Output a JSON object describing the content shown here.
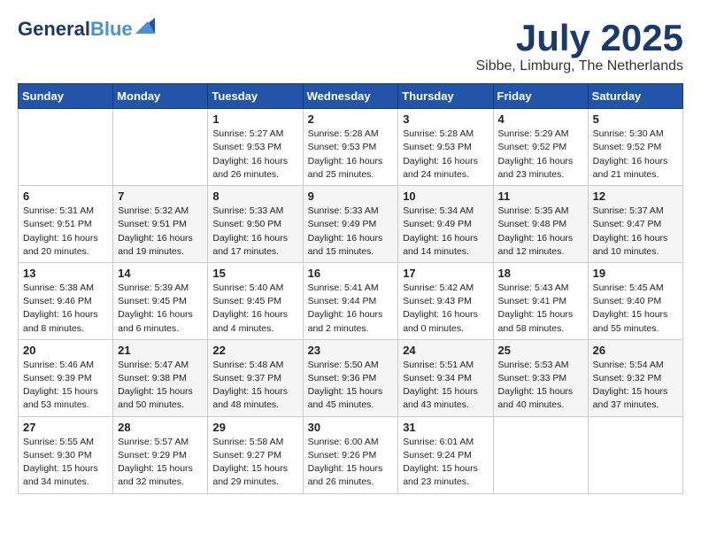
{
  "logo": {
    "line1": "General",
    "line2": "Blue"
  },
  "title": "July 2025",
  "location": "Sibbe, Limburg, The Netherlands",
  "weekdays": [
    "Sunday",
    "Monday",
    "Tuesday",
    "Wednesday",
    "Thursday",
    "Friday",
    "Saturday"
  ],
  "weeks": [
    [
      {
        "day": "",
        "info": ""
      },
      {
        "day": "",
        "info": ""
      },
      {
        "day": "1",
        "info": "Sunrise: 5:27 AM\nSunset: 9:53 PM\nDaylight: 16 hours\nand 26 minutes."
      },
      {
        "day": "2",
        "info": "Sunrise: 5:28 AM\nSunset: 9:53 PM\nDaylight: 16 hours\nand 25 minutes."
      },
      {
        "day": "3",
        "info": "Sunrise: 5:28 AM\nSunset: 9:53 PM\nDaylight: 16 hours\nand 24 minutes."
      },
      {
        "day": "4",
        "info": "Sunrise: 5:29 AM\nSunset: 9:52 PM\nDaylight: 16 hours\nand 23 minutes."
      },
      {
        "day": "5",
        "info": "Sunrise: 5:30 AM\nSunset: 9:52 PM\nDaylight: 16 hours\nand 21 minutes."
      }
    ],
    [
      {
        "day": "6",
        "info": "Sunrise: 5:31 AM\nSunset: 9:51 PM\nDaylight: 16 hours\nand 20 minutes."
      },
      {
        "day": "7",
        "info": "Sunrise: 5:32 AM\nSunset: 9:51 PM\nDaylight: 16 hours\nand 19 minutes."
      },
      {
        "day": "8",
        "info": "Sunrise: 5:33 AM\nSunset: 9:50 PM\nDaylight: 16 hours\nand 17 minutes."
      },
      {
        "day": "9",
        "info": "Sunrise: 5:33 AM\nSunset: 9:49 PM\nDaylight: 16 hours\nand 15 minutes."
      },
      {
        "day": "10",
        "info": "Sunrise: 5:34 AM\nSunset: 9:49 PM\nDaylight: 16 hours\nand 14 minutes."
      },
      {
        "day": "11",
        "info": "Sunrise: 5:35 AM\nSunset: 9:48 PM\nDaylight: 16 hours\nand 12 minutes."
      },
      {
        "day": "12",
        "info": "Sunrise: 5:37 AM\nSunset: 9:47 PM\nDaylight: 16 hours\nand 10 minutes."
      }
    ],
    [
      {
        "day": "13",
        "info": "Sunrise: 5:38 AM\nSunset: 9:46 PM\nDaylight: 16 hours\nand 8 minutes."
      },
      {
        "day": "14",
        "info": "Sunrise: 5:39 AM\nSunset: 9:45 PM\nDaylight: 16 hours\nand 6 minutes."
      },
      {
        "day": "15",
        "info": "Sunrise: 5:40 AM\nSunset: 9:45 PM\nDaylight: 16 hours\nand 4 minutes."
      },
      {
        "day": "16",
        "info": "Sunrise: 5:41 AM\nSunset: 9:44 PM\nDaylight: 16 hours\nand 2 minutes."
      },
      {
        "day": "17",
        "info": "Sunrise: 5:42 AM\nSunset: 9:43 PM\nDaylight: 16 hours\nand 0 minutes."
      },
      {
        "day": "18",
        "info": "Sunrise: 5:43 AM\nSunset: 9:41 PM\nDaylight: 15 hours\nand 58 minutes."
      },
      {
        "day": "19",
        "info": "Sunrise: 5:45 AM\nSunset: 9:40 PM\nDaylight: 15 hours\nand 55 minutes."
      }
    ],
    [
      {
        "day": "20",
        "info": "Sunrise: 5:46 AM\nSunset: 9:39 PM\nDaylight: 15 hours\nand 53 minutes."
      },
      {
        "day": "21",
        "info": "Sunrise: 5:47 AM\nSunset: 9:38 PM\nDaylight: 15 hours\nand 50 minutes."
      },
      {
        "day": "22",
        "info": "Sunrise: 5:48 AM\nSunset: 9:37 PM\nDaylight: 15 hours\nand 48 minutes."
      },
      {
        "day": "23",
        "info": "Sunrise: 5:50 AM\nSunset: 9:36 PM\nDaylight: 15 hours\nand 45 minutes."
      },
      {
        "day": "24",
        "info": "Sunrise: 5:51 AM\nSunset: 9:34 PM\nDaylight: 15 hours\nand 43 minutes."
      },
      {
        "day": "25",
        "info": "Sunrise: 5:53 AM\nSunset: 9:33 PM\nDaylight: 15 hours\nand 40 minutes."
      },
      {
        "day": "26",
        "info": "Sunrise: 5:54 AM\nSunset: 9:32 PM\nDaylight: 15 hours\nand 37 minutes."
      }
    ],
    [
      {
        "day": "27",
        "info": "Sunrise: 5:55 AM\nSunset: 9:30 PM\nDaylight: 15 hours\nand 34 minutes."
      },
      {
        "day": "28",
        "info": "Sunrise: 5:57 AM\nSunset: 9:29 PM\nDaylight: 15 hours\nand 32 minutes."
      },
      {
        "day": "29",
        "info": "Sunrise: 5:58 AM\nSunset: 9:27 PM\nDaylight: 15 hours\nand 29 minutes."
      },
      {
        "day": "30",
        "info": "Sunrise: 6:00 AM\nSunset: 9:26 PM\nDaylight: 15 hours\nand 26 minutes."
      },
      {
        "day": "31",
        "info": "Sunrise: 6:01 AM\nSunset: 9:24 PM\nDaylight: 15 hours\nand 23 minutes."
      },
      {
        "day": "",
        "info": ""
      },
      {
        "day": "",
        "info": ""
      }
    ]
  ]
}
